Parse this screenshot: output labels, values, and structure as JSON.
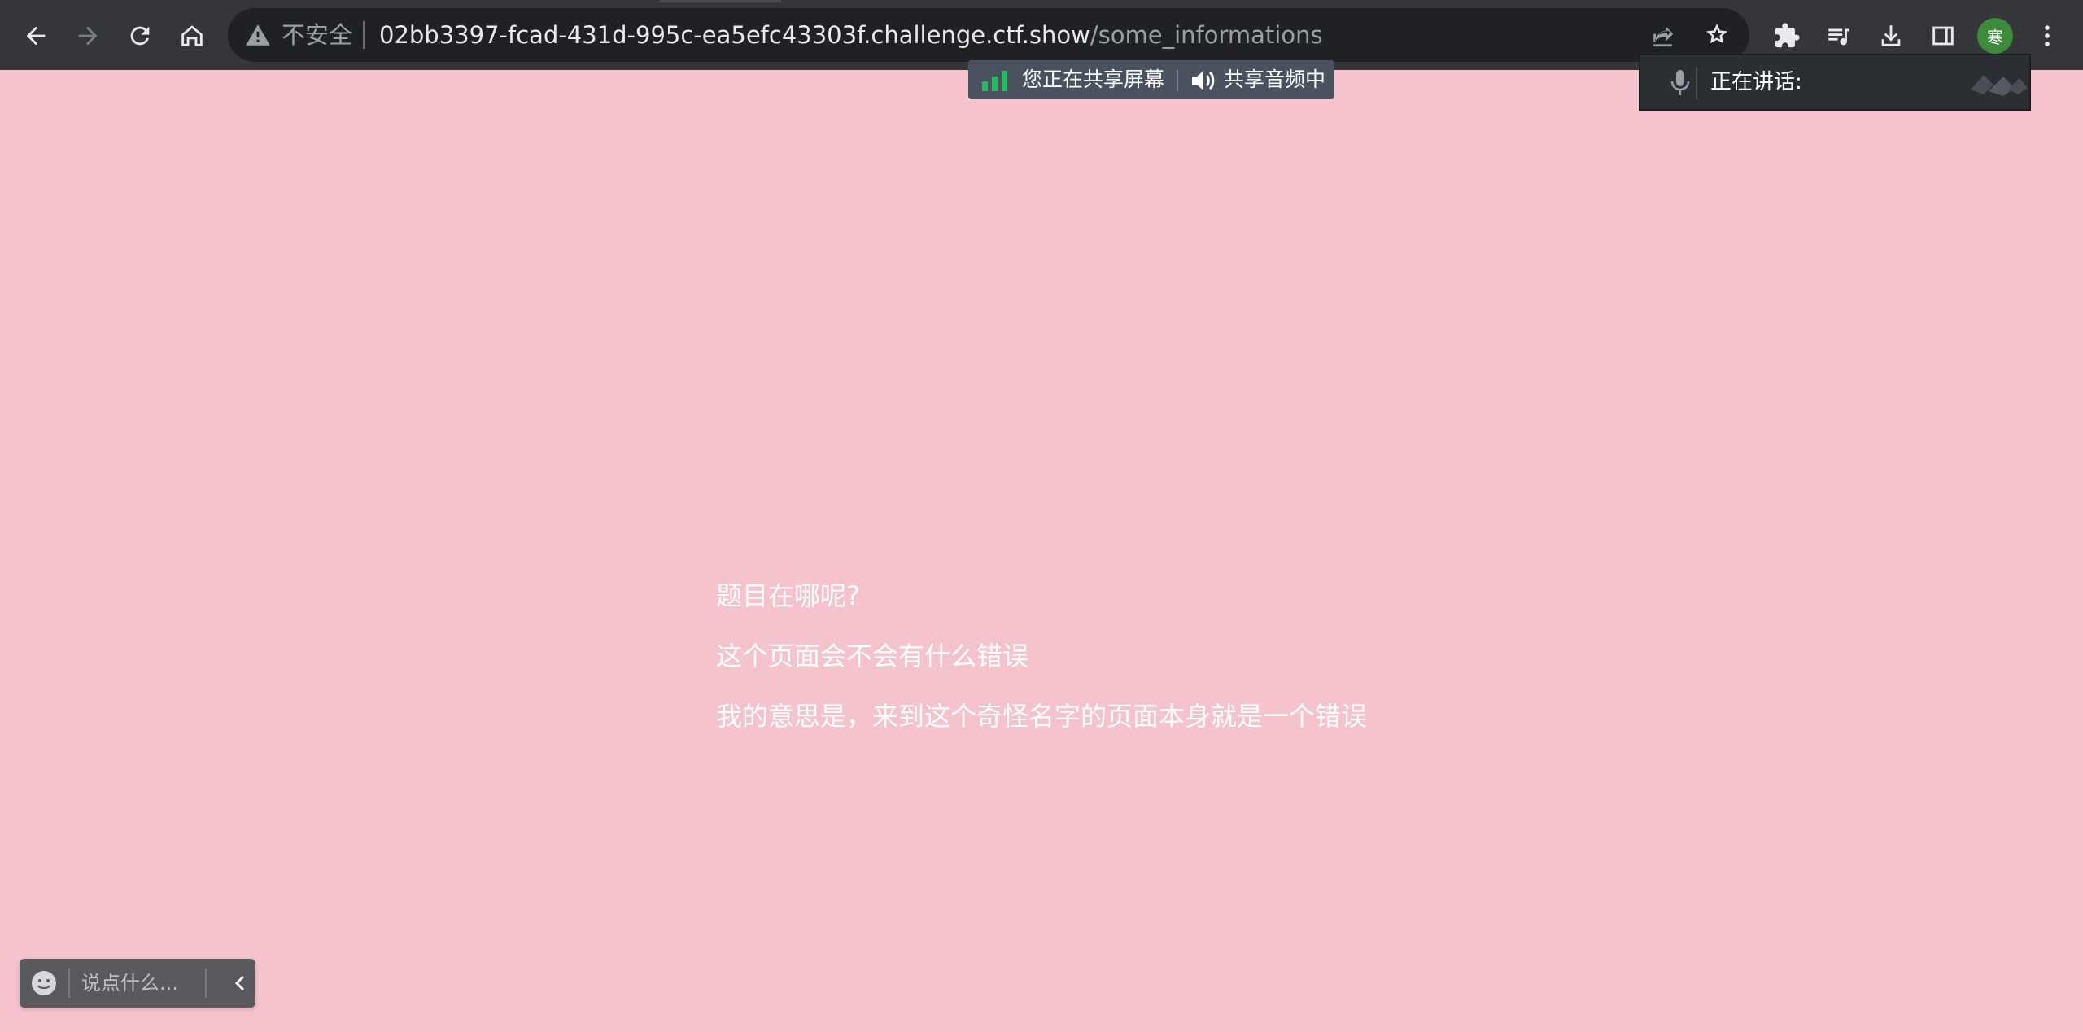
{
  "browser": {
    "address_bar": {
      "security_label": "不安全",
      "url_host": "02bb3397-fcad-431d-995c-ea5efc43303f.challenge.ctf.show",
      "url_path": "/some_informations"
    },
    "profile_avatar_text": "寒",
    "icons": [
      "back-arrow-icon",
      "forward-arrow-icon",
      "reload-icon",
      "home-icon",
      "warning-icon",
      "share-icon",
      "star-icon",
      "puzzle-icon",
      "media-queue-icon",
      "download-icon",
      "side-panel-icon",
      "more-vert-icon"
    ]
  },
  "screen_share": {
    "sharing_text": "您正在共享屏幕",
    "audio_text": "共享音频中",
    "signal_color": "#1dbf5a"
  },
  "speaking_panel": {
    "label": "正在讲话:"
  },
  "page": {
    "background_color": "#f5c3cc",
    "lines": [
      "题目在哪呢?",
      "这个页面会不会有什么错误",
      "我的意思是，来到这个奇怪名字的页面本身就是一个错误"
    ]
  },
  "chat_widget": {
    "placeholder": "说点什么..."
  }
}
